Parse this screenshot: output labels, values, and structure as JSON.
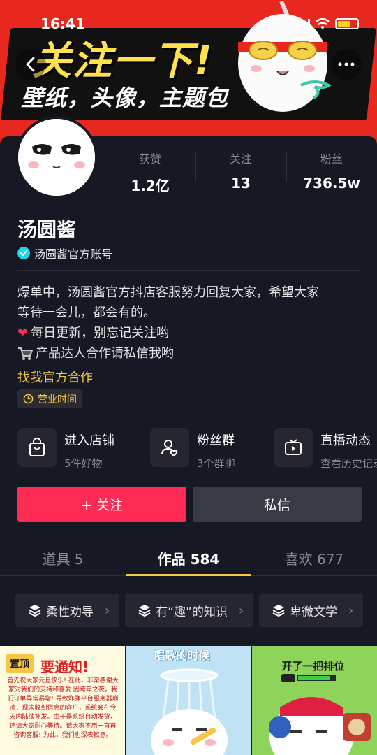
{
  "status_bar": {
    "time": "16:41"
  },
  "banner": {
    "title": "关注一下!",
    "subtitle": "壁纸，头像，主题包"
  },
  "profile": {
    "name": "汤圆酱",
    "verified_label": "汤圆酱官方账号",
    "stats": [
      {
        "label": "获赞",
        "value": "1.2亿"
      },
      {
        "label": "关注",
        "value": "13"
      },
      {
        "label": "粉丝",
        "value": "736.5w"
      }
    ],
    "bio": [
      "爆单中，汤圆酱官方抖店客服努力回复大家，希望大家",
      "等待一会儿，都会有的。",
      "每日更新，别忘记关注哟",
      "产品达人合作请私信我哟"
    ],
    "link": "找我官方合作",
    "hours_tag": "营业时间"
  },
  "services": [
    {
      "title": "进入店铺",
      "subtitle": "5件好物"
    },
    {
      "title": "粉丝群",
      "subtitle": "3个群聊"
    },
    {
      "title": "直播动态",
      "subtitle": "查看历史记录"
    }
  ],
  "actions": {
    "follow": "+ 关注",
    "message": "私信"
  },
  "tabs": [
    {
      "label": "道具 5"
    },
    {
      "label": "作品 584"
    },
    {
      "label": "喜欢 677"
    }
  ],
  "collections": [
    {
      "label": "柔性劝导"
    },
    {
      "label": "有“趣”的知识"
    },
    {
      "label": "卑微文学"
    }
  ],
  "grid": {
    "pin_label": "置顶",
    "tile1_head": "要通知!",
    "tile1_body": "首先祝大家元旦快乐! 在此，非常感谢大家对我们的支持和喜爱 因跨年之夜，我们订单异常暴增! 导致炸弹平台服务器崩溃，现未收到信息的客户，系统会在今天内陆续补发。由于是系统自动发货，还请大家耐心等待。请大家不用一直再咨询客服! 为此，我们也深表歉意。",
    "tile2_text": "唱歌的时候",
    "tile3_text": "开了一把排位"
  },
  "colors": {
    "accent_red": "#fe2c55",
    "accent_yellow": "#f5c744",
    "verified": "#20d5ec",
    "background": "#161823"
  }
}
